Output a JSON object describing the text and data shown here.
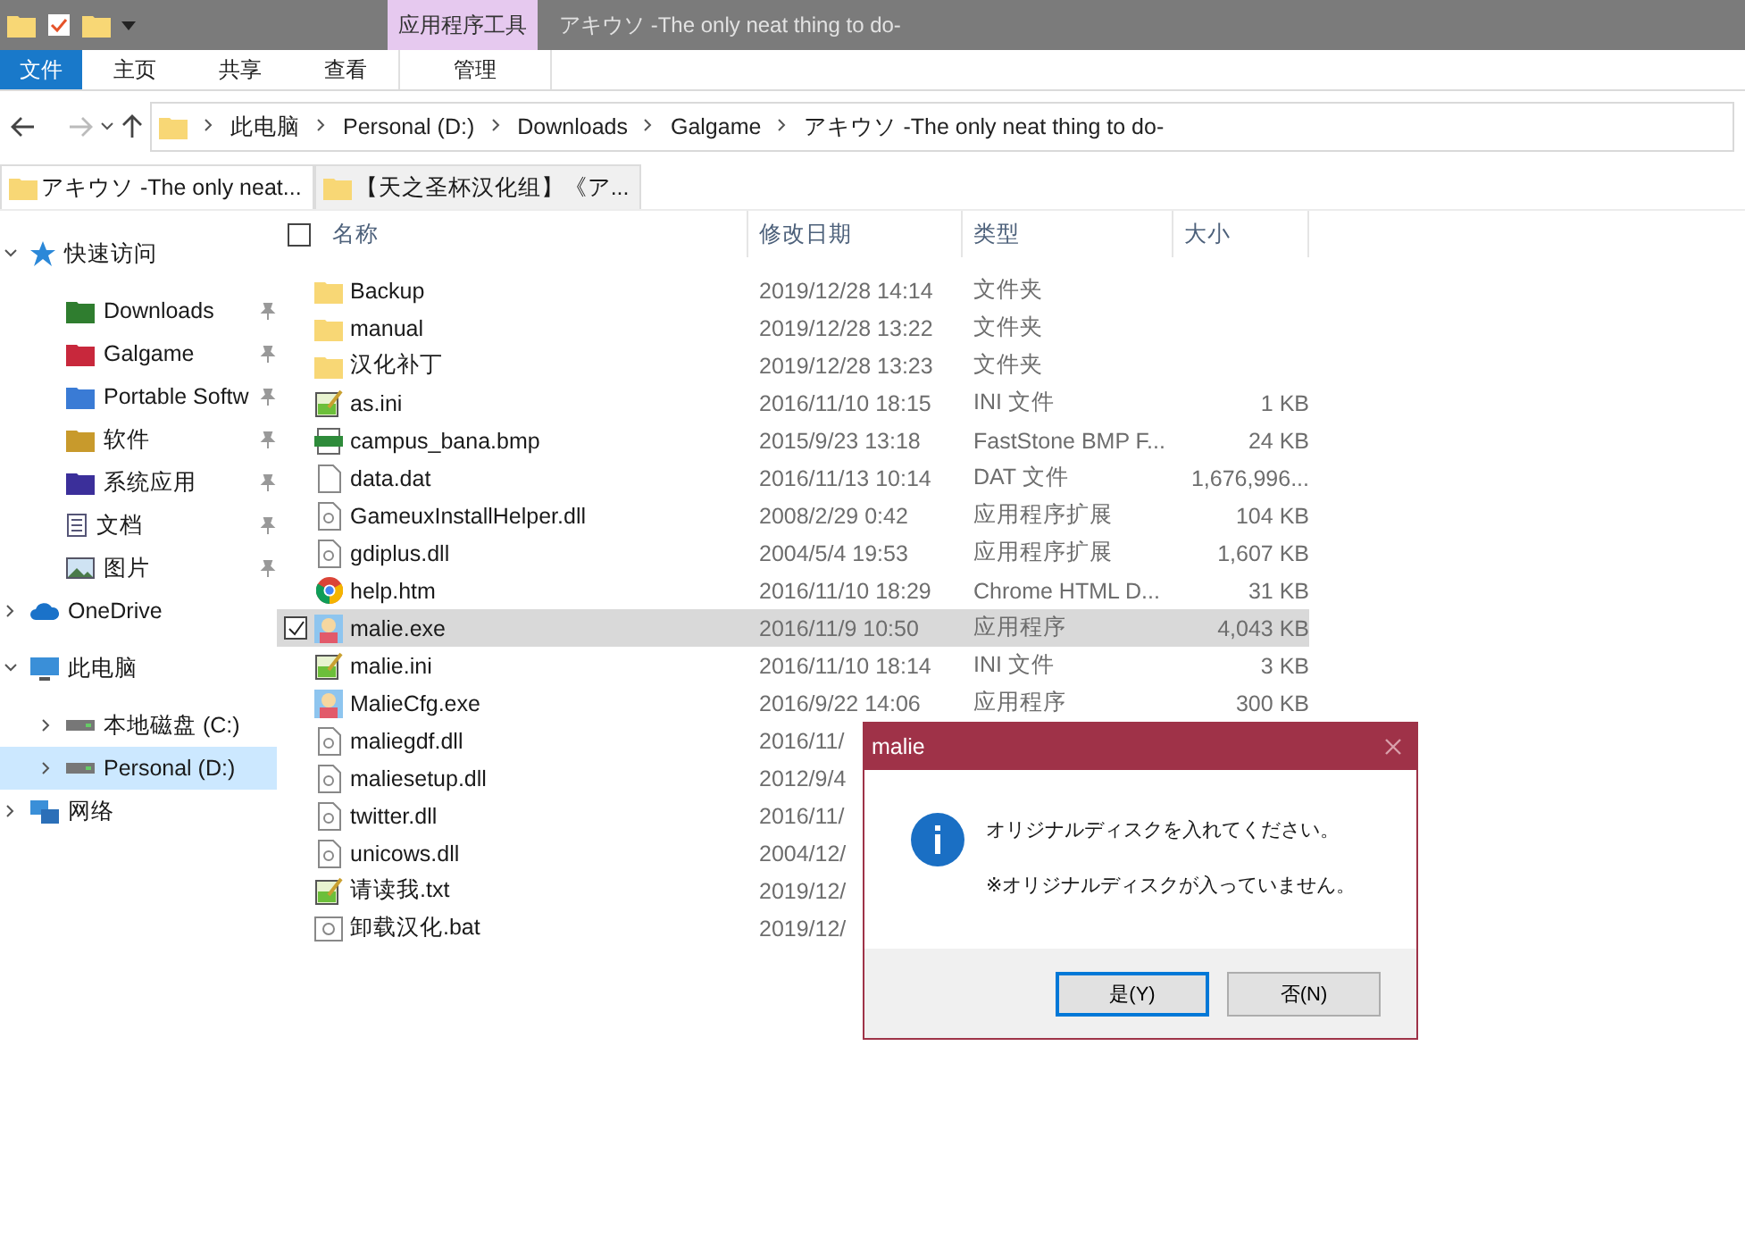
{
  "window": {
    "title": "アキウソ -The only neat thing to do-",
    "context_tab": "应用程序工具"
  },
  "ribbon": {
    "tabs": [
      {
        "label": "文件",
        "kind": "file"
      },
      {
        "label": "主页",
        "kind": "tab"
      },
      {
        "label": "共享",
        "kind": "tab"
      },
      {
        "label": "查看",
        "kind": "tab"
      },
      {
        "label": "管理",
        "kind": "context"
      }
    ]
  },
  "address_bar": {
    "path": [
      "此电脑",
      "Personal (D:)",
      "Downloads",
      "Galgame",
      "アキウソ -The only neat thing to do-"
    ]
  },
  "folder_tabs": [
    {
      "label": "アキウソ -The only neat...",
      "selected": true
    },
    {
      "label": "【天之圣杯汉化组】《ア...",
      "selected": false
    }
  ],
  "sidebar": {
    "items": [
      {
        "label": "快速访问",
        "kind": "star",
        "expanded": true,
        "selected": false,
        "children": [
          {
            "label": "Downloads",
            "kind": "downloads",
            "pinned": true,
            "selected": false
          },
          {
            "label": "Galgame",
            "kind": "redfolder",
            "pinned": true,
            "selected": false
          },
          {
            "label": "Portable Softw",
            "kind": "bluefolder",
            "pinned": true,
            "selected": false
          },
          {
            "label": "软件",
            "kind": "yellowfolder",
            "pinned": true,
            "selected": false
          },
          {
            "label": "系统应用",
            "kind": "purplefolder",
            "pinned": true,
            "selected": false
          },
          {
            "label": "文档",
            "kind": "doc",
            "pinned": true,
            "selected": false
          },
          {
            "label": "图片",
            "kind": "image",
            "pinned": true,
            "selected": false
          }
        ]
      },
      {
        "label": "OneDrive",
        "kind": "cloud",
        "expanded": false,
        "selected": false
      },
      {
        "label": "此电脑",
        "kind": "pc",
        "expanded": true,
        "selected": false,
        "children": [
          {
            "label": "本地磁盘 (C:)",
            "kind": "drive",
            "expanded": false,
            "selected": false
          },
          {
            "label": "Personal (D:)",
            "kind": "drive",
            "expanded": false,
            "selected": true
          }
        ]
      },
      {
        "label": "网络",
        "kind": "network",
        "expanded": false,
        "selected": false
      }
    ]
  },
  "table": {
    "select_all": false,
    "columns": [
      "名称",
      "修改日期",
      "类型",
      "大小"
    ],
    "rows": [
      {
        "name": "Backup",
        "kind": "folder",
        "date": "2019/12/28 14:14",
        "type": "文件夹",
        "selected": false
      },
      {
        "name": "manual",
        "kind": "folder",
        "date": "2019/12/28 13:22",
        "type": "文件夹",
        "selected": false
      },
      {
        "name": "汉化补丁",
        "kind": "folder",
        "date": "2019/12/28 13:23",
        "type": "文件夹",
        "selected": false
      },
      {
        "name": "as.ini",
        "kind": "ini",
        "date": "2016/11/10 18:15",
        "type": "INI 文件",
        "size": "1 KB",
        "selected": false
      },
      {
        "name": "campus_bana.bmp",
        "kind": "bmp",
        "date": "2015/9/23 13:18",
        "type": "FastStone BMP F...",
        "size": "24 KB",
        "selected": false
      },
      {
        "name": "data.dat",
        "kind": "file",
        "date": "2016/11/13 10:14",
        "type": "DAT 文件",
        "size": "1,676,996...",
        "selected": false
      },
      {
        "name": "GameuxInstallHelper.dll",
        "kind": "dll",
        "date": "2008/2/29 0:42",
        "type": "应用程序扩展",
        "size": "104 KB",
        "selected": false
      },
      {
        "name": "gdiplus.dll",
        "kind": "dll",
        "date": "2004/5/4 19:53",
        "type": "应用程序扩展",
        "size": "1,607 KB",
        "selected": false
      },
      {
        "name": "help.htm",
        "kind": "chrome",
        "date": "2016/11/10 18:29",
        "type": "Chrome HTML D...",
        "size": "31 KB",
        "selected": false
      },
      {
        "name": "malie.exe",
        "kind": "exe",
        "date": "2016/11/9 10:50",
        "type": "应用程序",
        "size": "4,043 KB",
        "selected": true
      },
      {
        "name": "malie.ini",
        "kind": "ini",
        "date": "2016/11/10 18:14",
        "type": "INI 文件",
        "size": "3 KB",
        "selected": false
      },
      {
        "name": "MalieCfg.exe",
        "kind": "exe",
        "date": "2016/9/22 14:06",
        "type": "应用程序",
        "size": "300 KB",
        "selected": false
      },
      {
        "name": "maliegdf.dll",
        "kind": "dll",
        "date": "2016/11/",
        "selected": false
      },
      {
        "name": "maliesetup.dll",
        "kind": "dll",
        "date": "2012/9/4",
        "selected": false
      },
      {
        "name": "twitter.dll",
        "kind": "dll",
        "date": "2016/11/",
        "selected": false
      },
      {
        "name": "unicows.dll",
        "kind": "dll",
        "date": "2004/12/",
        "selected": false
      },
      {
        "name": "请读我.txt",
        "kind": "ini",
        "date": "2019/12/",
        "selected": false
      },
      {
        "name": "卸载汉化.bat",
        "kind": "bat",
        "date": "2019/12/",
        "selected": false
      }
    ]
  },
  "dialog": {
    "title": "malie",
    "message": "オリジナルディスクを入れてください。",
    "note": "※オリジナルディスクが入っていません。",
    "buttons": [
      {
        "label": "是(Y)",
        "selected": true
      },
      {
        "label": "否(N)",
        "selected": false
      }
    ]
  }
}
